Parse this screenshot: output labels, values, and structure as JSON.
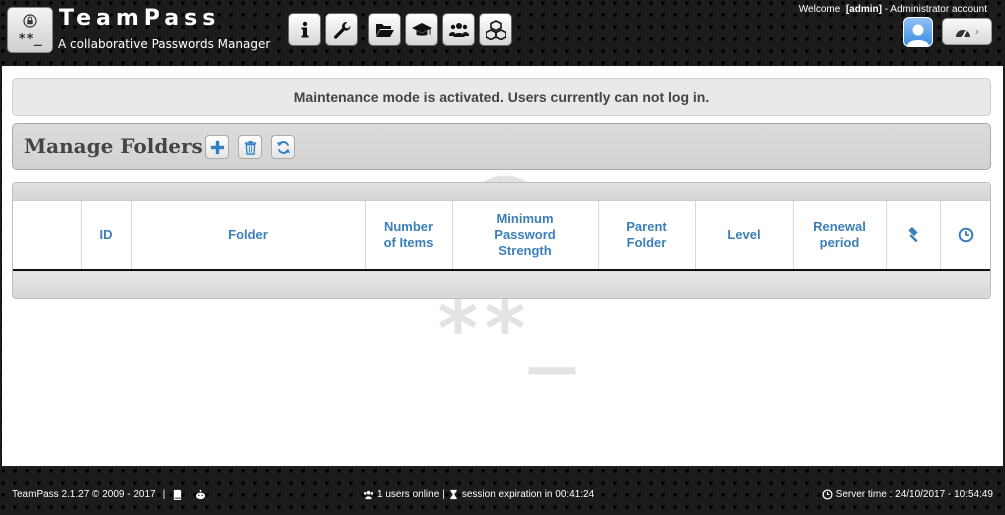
{
  "app": {
    "title": "TeamPass",
    "subtitle": "A collaborative Passwords Manager",
    "logo_text": "**_"
  },
  "header": {
    "nav_icons": [
      "info-icon",
      "wrench-icon",
      "folder-open-icon",
      "graduation-cap-icon",
      "users-icon",
      "cubes-icon"
    ],
    "welcome_label": "Welcome",
    "username": "[admin]",
    "account_type": "- Administrator account"
  },
  "main": {
    "maintenance_message": "Maintenance mode is activated. Users currently can not log in.",
    "page_title": "Manage Folders",
    "toolbar_icons": [
      "plus-icon",
      "trash-icon",
      "refresh-icon"
    ],
    "table": {
      "columns": [
        "",
        "ID",
        "Folder",
        "Number of Items",
        "Minimum Password Strength",
        "Parent Folder",
        "Level",
        "Renewal period",
        "gavel-icon",
        "clock-icon"
      ]
    }
  },
  "footer": {
    "version": "TeamPass 2.1.27 © 2009 - 2017",
    "separator": "|",
    "users_online": "1 users online",
    "session_separator": "|",
    "session_expiration": "session expiration in 00:41:24",
    "server_time": "Server time : 24/10/2017 - 10:54:49"
  },
  "colors": {
    "header_bg": "#1c1c1c",
    "table_header_text": "#3a7fb8",
    "maintenance_bg": "#e9e9e9"
  }
}
